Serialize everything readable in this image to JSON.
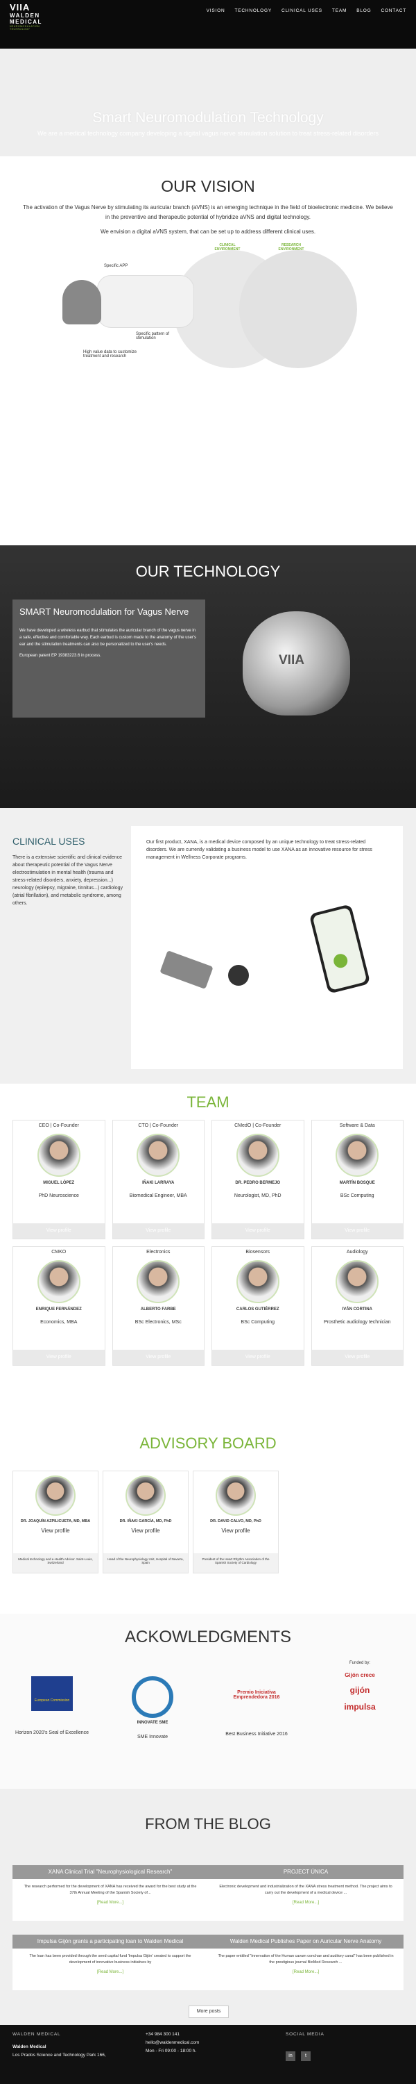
{
  "header": {
    "logo_mark": "VIIA",
    "logo_name": "WALDEN MEDICAL",
    "logo_tag": "NEUROMODULATION TECHNOLOGY",
    "nav": [
      "VISION",
      "TECHNOLOGY",
      "CLINICAL USES",
      "TEAM",
      "BLOG",
      "CONTACT"
    ]
  },
  "hero": {
    "title": "Smart Neuromodulation Technology",
    "subtitle": "We are a medical technology company developing a digital vagus nerve stimulation solution to treat stress-related disorders"
  },
  "vision": {
    "title": "OUR VISION",
    "text1": "The activation of the Vagus Nerve by stimulating its auricular branch (aVNS) is an emerging technique in the field of bioelectronic medicine. We believe in the preventive and therapeutic potential of hybridize aVNS and digital technology.",
    "text2": "We envision a digital aVNS system, that can be set up to address different clinical uses.",
    "diagram": {
      "label_app": "Specific APP",
      "label_pattern": "Specific pattern of stimulation",
      "label_data": "High value data to customize treatment and research",
      "label_clinical": "CLINICAL ENVIRONMENT",
      "label_research": "RESEARCH ENVIRONMENT"
    }
  },
  "technology": {
    "title": "OUR TECHNOLOGY",
    "panel_title": "SMART Neuromodulation for Vagus Nerve",
    "panel_body": "We have developed a wireless earbud that stimulates the auricular branch of the vagus nerve in a safe, effective and comfortable way. Each earbud is custom made to the anatomy of the user's ear and the stimulation treatments can also be personalized to the user's needs.",
    "patent": "European patent EP 19383223.6 in process.",
    "device_mark": "VIIA"
  },
  "clinical": {
    "title": "CLINICAL USES",
    "left_text": "There is a extensive scientific and clinical evidence about therapeutic potential of the Vagus Nerve electrostimulation in mental health (trauma and stress-related disorders, anxiety, depression...) neurology (epilepsy, migraine, tinnitus...) cardiology (atrial fibrillation), and metabolic syndrome, among others.",
    "card_text": "Our first product, XANA, is a medical device composed by an unique technology to treat stress-related disorders. We are currently validating a business model to use XANA as an innovative resource for stress management in Wellness Corporate programs."
  },
  "team": {
    "title": "TEAM",
    "view_profile": "View profile",
    "members": [
      {
        "role": "CEO | Co-Founder",
        "name": "MIGUEL LÓPEZ",
        "desc": "PhD Neuroscience"
      },
      {
        "role": "CTO | Co-Founder",
        "name": "IÑAKI LARRAYA",
        "desc": "Biomedical Engineer, MBA"
      },
      {
        "role": "CMedO | Co-Founder",
        "name": "DR. PEDRO BERMEJO",
        "desc": "Neurologist, MD, PhD"
      },
      {
        "role": "Software & Data",
        "name": "MARTÍN BOSQUE",
        "desc": "BSc Computing"
      },
      {
        "role": "CMKO",
        "name": "ENRIQUE FERNÁNDEZ",
        "desc": "Economics, MBA"
      },
      {
        "role": "Electronics",
        "name": "ALBERTO FARBE",
        "desc": "BSc Electronics, MSc"
      },
      {
        "role": "Biosensors",
        "name": "CARLOS GUTIÉRREZ",
        "desc": "BSc Computing"
      },
      {
        "role": "Audiology",
        "name": "IVÁN CORTINA",
        "desc": "Prosthetic audiology technician"
      }
    ]
  },
  "advisory": {
    "title": "ADVISORY BOARD",
    "members": [
      {
        "name": "DR. JOAQUÍN AZPILICUETA, MD, MBA",
        "view": "View profile",
        "foot": "Medical technology and e-Health Advisor. Saint-Louis, Switzerland"
      },
      {
        "name": "DR. IÑAKI GARCÍA, MD, PhD",
        "view": "View profile",
        "foot": "Head of the Neurophysiology Unit, Hospital of Navarra, Spain"
      },
      {
        "name": "DR. DAVID CALVO, MD, PhD",
        "view": "View profile",
        "foot": "President of the Heart Rhythm Association of the Spanish Society of Cardiology"
      }
    ]
  },
  "ack": {
    "title": "ACKOWLEDGMENTS",
    "items": [
      {
        "caption": "Horizon 2020's Seal of Excellence",
        "logo": "European Commission"
      },
      {
        "caption": "SME Innovate",
        "logo": "INNOVATE SME"
      },
      {
        "caption": "Best Business Initiative 2016",
        "logo": "Premio Iniciativa Emprendedora 2016"
      }
    ],
    "funded_by": "Funded by:",
    "funded_logos": [
      "Gijón crece",
      "gijón",
      "impulsa"
    ]
  },
  "blog": {
    "title": "FROM THE BLOG",
    "posts": [
      {
        "title": "XANA Clinical Trial \"Neurophysiological Research\"",
        "body": "The research performed for the development of XANA has received the award for the best study at the 37th Annual Meeting of the Spanish Society of...",
        "more": "[Read More...]"
      },
      {
        "title": "PROJECT ÚNICA",
        "body": "Electronic development and industrialization of the XANA stress treatment method. The project aims to carry out the development of a medical device ...",
        "more": "[Read More...]"
      },
      {
        "title": "Impulsa Gijón grants a participating loan to Walden Medical",
        "body": "The loan has been provided through the seed capital fund 'Impulsa Gijón' created to support the development of innovative business initiatives by",
        "more": "[Read More...]"
      },
      {
        "title": "Walden Medical Publishes Paper on Auricular Nerve Anatomy",
        "body": "The paper entitled \"Innervation of the Human cavum conchae and auditory canal\" has been published in the prestigious journal BioMed Research ...",
        "more": "[Read More...]"
      }
    ],
    "more_posts": "More posts"
  },
  "footer": {
    "col1_title": "WALDEN MEDICAL",
    "company": "Walden Medical",
    "address": "Los Prados Science and Technology Park 166,",
    "phone": "+34 984 300 141",
    "email": "hello@waldenmedical.com",
    "hours": "Mon - Fri 09:00 - 18:00 h.",
    "social_title": "SOCIAL MEDIA",
    "social": [
      "in",
      "t"
    ]
  }
}
